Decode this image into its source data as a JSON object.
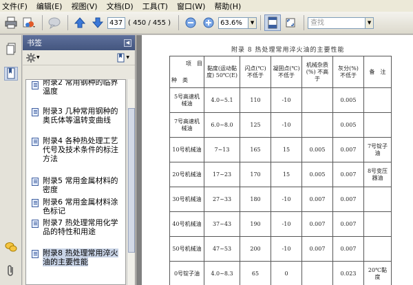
{
  "menu": [
    "文件(F)",
    "编辑(E)",
    "视图(V)",
    "文档(D)",
    "工具(T)",
    "窗口(W)",
    "帮助(H)"
  ],
  "toolbar": {
    "page_value": "437",
    "page_count": "( 450 / 455 )",
    "zoom_value": "63.6%",
    "search_placeholder": "查找"
  },
  "panel": {
    "title": "书签"
  },
  "bookmarks": [
    "附录2 常用钢种的临界温度",
    "附录3 几种常用钢种的奥氏体等温转变曲线",
    "附录4 各种热处理工艺代号及技术条件的标注方法",
    "附录5 常用金属材料的密度",
    "附录6 常用金属材料涂色标记",
    "附录7 热处理常用化学品的特性和用途",
    "附录8 热处理常用淬火油的主要性能"
  ],
  "document": {
    "title": "附录 8  热处理常用淬火油的主要性能",
    "header": {
      "corner_top": "项　目",
      "corner_bottom": "种　类",
      "cols": [
        "黏度(运动黏度) 50℃(E)",
        "闪点(℃) 不低于",
        "凝固点(℃) 不低于",
        "机械杂质(%) 不高于",
        "灰分(%) 不低于",
        "备　注"
      ]
    },
    "rows": [
      {
        "name": "5号高速机械油",
        "cells": [
          "4.0~5.1",
          "110",
          "-10",
          "",
          "0.005",
          ""
        ]
      },
      {
        "name": "7号高速机械油",
        "cells": [
          "6.0~8.0",
          "125",
          "-10",
          "",
          "0.005",
          ""
        ]
      },
      {
        "name": "10号机械油",
        "cells": [
          "7~13",
          "165",
          "15",
          "0.005",
          "0.007",
          "7号锭子油"
        ]
      },
      {
        "name": "20号机械油",
        "cells": [
          "17~23",
          "170",
          "15",
          "0.005",
          "0.007",
          "8号变压器油"
        ]
      },
      {
        "name": "30号机械油",
        "cells": [
          "27~33",
          "180",
          "-10",
          "0.007",
          "0.007",
          ""
        ]
      },
      {
        "name": "40号机械油",
        "cells": [
          "37~43",
          "190",
          "-10",
          "0.007",
          "0.007",
          ""
        ]
      },
      {
        "name": "50号机械油",
        "cells": [
          "47~53",
          "200",
          "-10",
          "0.007",
          "0.007",
          ""
        ]
      },
      {
        "name": "0号锭子油",
        "cells": [
          "4.0~8.3",
          "65",
          "0",
          "",
          "0.023",
          "20℃黏度"
        ]
      }
    ]
  }
}
